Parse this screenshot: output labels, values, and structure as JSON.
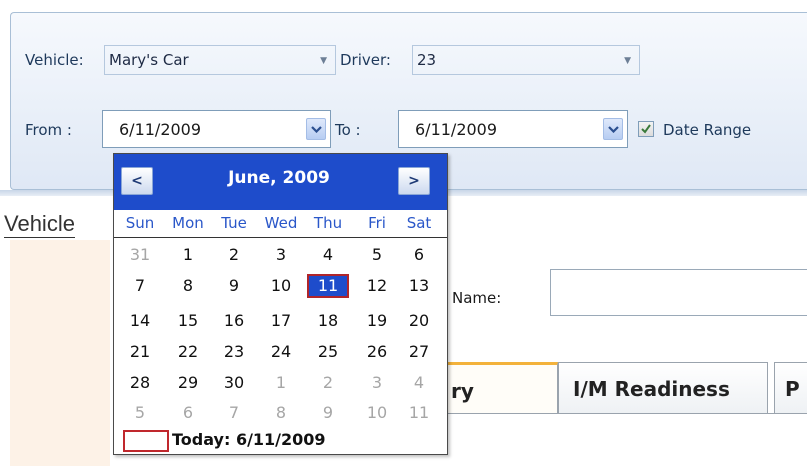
{
  "filters": {
    "vehicle_label": "Vehicle:",
    "vehicle_value": "Mary's Car",
    "driver_label": "Driver:",
    "driver_value": "23",
    "from_label": "From :",
    "from_value": "6/11/2009",
    "to_label": "To  :",
    "to_value": "6/11/2009",
    "date_range_label": "Date Range",
    "date_range_checked": true
  },
  "calendar": {
    "title": "June, 2009",
    "prev_label": "<",
    "next_label": ">",
    "day_names": [
      "Sun",
      "Mon",
      "Tue",
      "Wed",
      "Thu",
      "Fri",
      "Sat"
    ],
    "weeks": [
      [
        "31",
        "1",
        "2",
        "3",
        "4",
        "5",
        "6"
      ],
      [
        "7",
        "8",
        "9",
        "10",
        "11",
        "12",
        "13"
      ],
      [
        "14",
        "15",
        "16",
        "17",
        "18",
        "19",
        "20"
      ],
      [
        "21",
        "22",
        "23",
        "24",
        "25",
        "26",
        "27"
      ],
      [
        "28",
        "29",
        "30",
        "1",
        "2",
        "3",
        "4"
      ],
      [
        "5",
        "6",
        "7",
        "8",
        "9",
        "10",
        "11"
      ]
    ],
    "selected": "11",
    "today_label": "Today: 6/11/2009"
  },
  "main": {
    "section_tab": "Vehicle",
    "name_label": "Name:",
    "tabs": [
      "ry",
      "I/M Readiness",
      "P"
    ]
  },
  "colors": {
    "calendar_header": "#1e4ccb",
    "day_name_text": "#2a57c9",
    "today_marker": "#c0282d",
    "active_tab_accent": "#f3b23b"
  }
}
